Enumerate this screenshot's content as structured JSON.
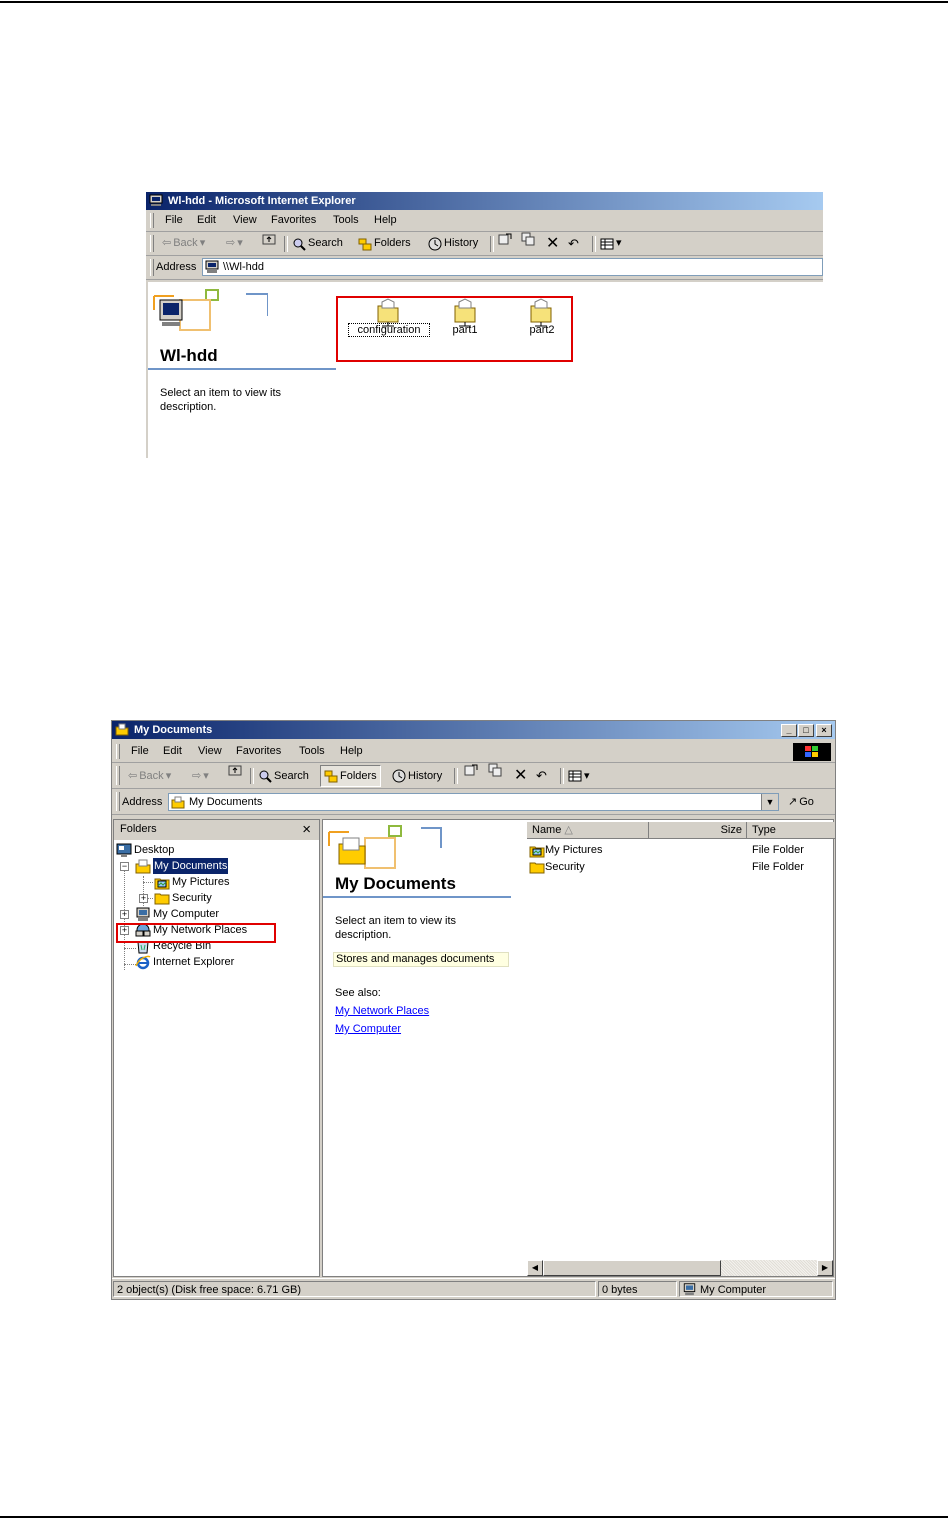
{
  "ie_window": {
    "title": "Wl-hdd - Microsoft Internet Explorer",
    "menu": [
      "File",
      "Edit",
      "View",
      "Favorites",
      "Tools",
      "Help"
    ],
    "toolbar": {
      "back": "Back",
      "search": "Search",
      "folders": "Folders",
      "history": "History"
    },
    "address_label": "Address",
    "address_value": "\\\\Wl-hdd",
    "panel_title": "Wl-hdd",
    "panel_text": "Select an item to view its description.",
    "folders": [
      {
        "label": "configuration",
        "icon": "shared-folder-icon"
      },
      {
        "label": "part1",
        "icon": "shared-folder-icon"
      },
      {
        "label": "part2",
        "icon": "shared-folder-icon"
      }
    ]
  },
  "explorer_window": {
    "title": "My Documents",
    "menu": [
      "File",
      "Edit",
      "View",
      "Favorites",
      "Tools",
      "Help"
    ],
    "toolbar": {
      "back": "Back",
      "search": "Search",
      "folders": "Folders",
      "history": "History"
    },
    "address_label": "Address",
    "address_value": "My Documents",
    "go_label": "Go",
    "folders_pane_title": "Folders",
    "close_glyph": "×",
    "tree": [
      {
        "label": "Desktop",
        "icon": "desktop-icon"
      },
      {
        "label": "My Documents",
        "icon": "my-documents-icon",
        "selected": true
      },
      {
        "label": "My Pictures",
        "icon": "my-pictures-icon"
      },
      {
        "label": "Security",
        "icon": "folder-icon"
      },
      {
        "label": "My Computer",
        "icon": "my-computer-icon"
      },
      {
        "label": "My Network Places",
        "icon": "network-places-icon"
      },
      {
        "label": "Recycle Bin",
        "icon": "recycle-bin-icon"
      },
      {
        "label": "Internet Explorer",
        "icon": "ie-icon"
      }
    ],
    "panel_title": "My Documents",
    "panel_text": "Select an item to view its description.",
    "panel_info": "Stores and manages documents",
    "see_also_label": "See also:",
    "see_also_links": [
      "My Network Places",
      "My Computer"
    ],
    "columns": {
      "name": "Name",
      "size": "Size",
      "type": "Type"
    },
    "files": [
      {
        "name": "My Pictures",
        "type": "File Folder",
        "icon": "my-pictures-icon"
      },
      {
        "name": "Security",
        "type": "File Folder",
        "icon": "folder-icon"
      }
    ],
    "status": {
      "objects": "2 object(s) (Disk free space: 6.71 GB)",
      "size": "0 bytes",
      "zone": "My Computer"
    }
  }
}
